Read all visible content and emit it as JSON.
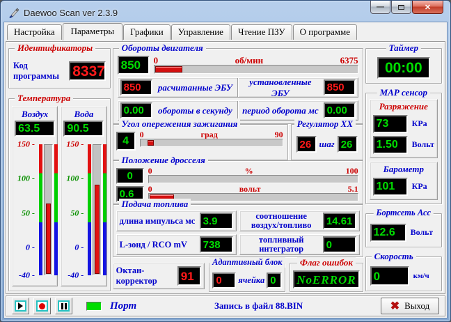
{
  "window": {
    "title": "Daewoo Scan ver 2.3.9"
  },
  "tabs": [
    {
      "label": "Настройка"
    },
    {
      "label": "Параметры"
    },
    {
      "label": "Графики"
    },
    {
      "label": "Управление"
    },
    {
      "label": "Чтение ПЗУ"
    },
    {
      "label": "О программе"
    }
  ],
  "identifiers": {
    "title": "Идентификаторы",
    "code_label": "Код программы",
    "code_value": "8337"
  },
  "temperature": {
    "title": "Температура",
    "scale": {
      "min": -40,
      "max": 150,
      "ticks": [
        {
          "v": 150,
          "color": "#cc0000"
        },
        {
          "v": 100,
          "color": "#0a9000"
        },
        {
          "v": 50,
          "color": "#0a9000"
        },
        {
          "v": 0,
          "color": "#0000cc"
        },
        {
          "v": -40,
          "color": "#0000cc"
        }
      ]
    },
    "panels": [
      {
        "name": "Воздух",
        "display": "63.5",
        "value": 63.5
      },
      {
        "name": "Вода",
        "display": "90.5",
        "value": 90.5
      }
    ]
  },
  "rpm": {
    "title": "Обороты двигателя",
    "main": {
      "display": "850",
      "value": 850,
      "min": 0,
      "max": 6375,
      "min_label": "0",
      "unit": "об/мин",
      "max_label": "6375"
    },
    "calc_value": "850",
    "calc_label": "расчитанные ЭБУ",
    "set_label": "установленные ЭБУ",
    "set_value": "850",
    "rps_value": "0.00",
    "rps_label": "обороты в секунду",
    "period_label": "период оборота  мс",
    "period_value": "0.00"
  },
  "ignition": {
    "title": "Угол опережения зажигания",
    "display": "4",
    "value": 4,
    "min": 0,
    "max": 90,
    "min_label": "0",
    "unit": "град",
    "max_label": "90",
    "marker": true
  },
  "idle_regulator": {
    "title": "Регулятор ХХ",
    "left_value": "26",
    "step_label": "шаг",
    "right_value": "26"
  },
  "throttle": {
    "title": "Положение дросселя",
    "percent": {
      "display": "0",
      "value": 0,
      "min": 0,
      "max": 100,
      "min_label": "0",
      "unit": "%",
      "max_label": "100"
    },
    "volts": {
      "display": "0.6",
      "value": 0.6,
      "min": 0,
      "max": 5.1,
      "min_label": "0",
      "unit": "вольт",
      "max_label": "5.1"
    }
  },
  "fuel": {
    "title": "Подача топлива",
    "pulse_label": "длина импульса  мс",
    "pulse_value": "3.9",
    "ratio_label_1": "соотношение",
    "ratio_label_2": "воздух/топливо",
    "ratio_value": "14.61",
    "lambda_label": "L-зонд / RCO  mV",
    "lambda_value": "738",
    "integrator_label_1": "топливный",
    "integrator_label_2": "интегратор",
    "integrator_value": "0"
  },
  "octane": {
    "label": "Октан-корректор",
    "value": "91"
  },
  "adaptive": {
    "title": "Адаптивный блок",
    "left_value": "0",
    "cell_label": "ячейка",
    "right_value": "0"
  },
  "error_flag": {
    "title": "Флаг ошибок",
    "value": "NoERROR"
  },
  "timer": {
    "title": "Таймер",
    "value": "00:00"
  },
  "map_sensor": {
    "title": "МАР сенсор",
    "vacuum": {
      "title": "Разряжение",
      "kpa_value": "73",
      "kpa_unit": "КРа",
      "volt_value": "1.50",
      "volt_unit": "Вольт"
    },
    "barometer": {
      "title": "Барометр",
      "kpa_value": "101",
      "kpa_unit": "КРа"
    }
  },
  "board_net": {
    "title": "Бортсеть Асс",
    "value": "12.6",
    "unit": "Вольт"
  },
  "speed": {
    "title": "Скорость",
    "value": "0",
    "unit": "км/ч"
  },
  "statusbar": {
    "port_label": "Порт",
    "record_text": "Запись в файл 88.BIN",
    "exit_label": "Выход"
  },
  "colors": {
    "display_green": "#00dd00",
    "display_red": "#ff1a1a",
    "label_blue": "#0000cc",
    "label_red": "#cc0000"
  }
}
